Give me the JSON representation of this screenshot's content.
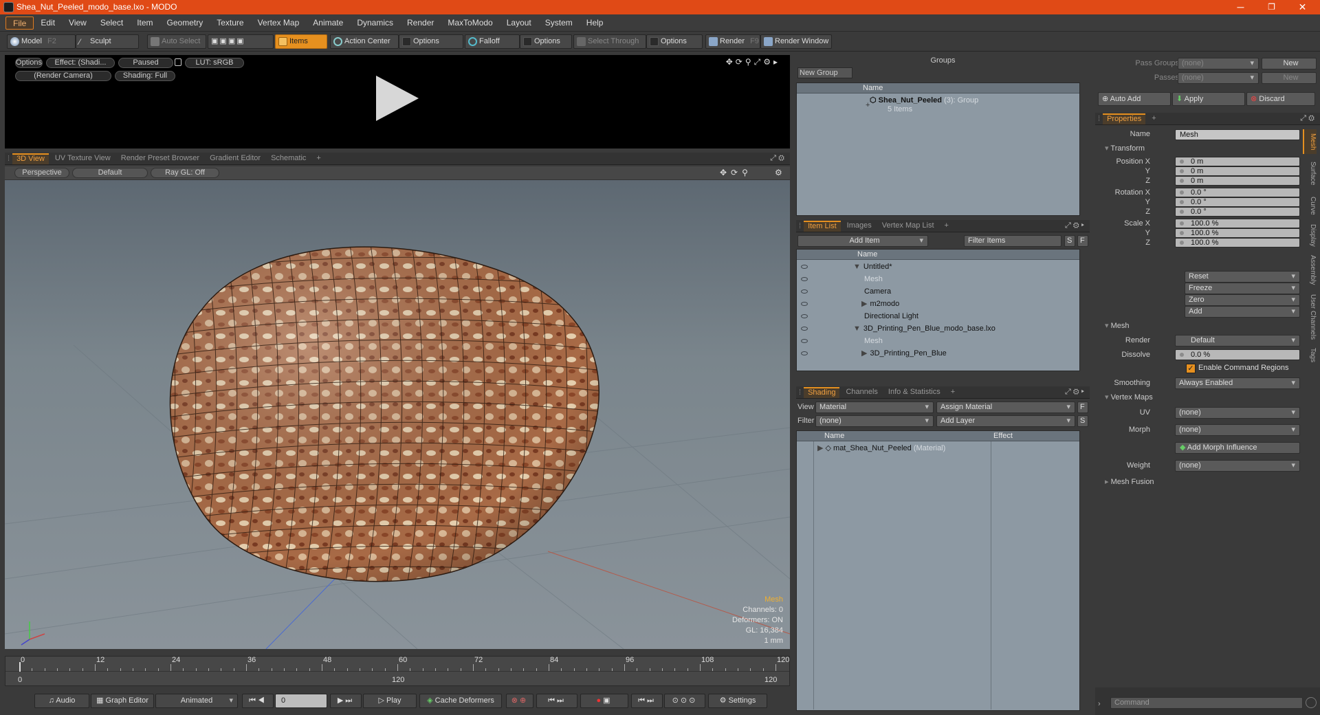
{
  "window": {
    "title": "Shea_Nut_Peeled_modo_base.lxo - MODO",
    "minimize": "─",
    "restore": "❐",
    "close": "✕"
  },
  "menu": [
    "File",
    "Edit",
    "View",
    "Select",
    "Item",
    "Geometry",
    "Texture",
    "Vertex Map",
    "Animate",
    "Dynamics",
    "Render",
    "MaxToModo",
    "Layout",
    "System",
    "Help"
  ],
  "toolbar": {
    "model": "Model",
    "model_key": "F2",
    "sculpt": "Sculpt",
    "auto_select": "Auto Select",
    "items": "Items",
    "action_center": "Action Center",
    "options1": "Options",
    "falloff": "Falloff",
    "options2": "Options",
    "select_through": "Select Through",
    "options3": "Options",
    "render": "Render",
    "render_key": "F9",
    "render_window": "Render Window"
  },
  "preview": {
    "options": "Options",
    "effect": "Effect: (Shadi...",
    "paused": "Paused",
    "lut": "LUT: sRGB",
    "camera": "(Render Camera)",
    "shading": "Shading: Full"
  },
  "view_tabs": [
    "3D View",
    "UV Texture View",
    "Render Preset Browser",
    "Gradient Editor",
    "Schematic",
    "+"
  ],
  "viewport": {
    "projection": "Perspective",
    "style": "Default",
    "raygl": "Ray GL: Off",
    "info": {
      "selection": "Mesh",
      "channels": "Channels: 0",
      "deformers": "Deformers: ON",
      "gl": "GL: 16,384",
      "unit": "1 mm"
    }
  },
  "timeline": {
    "ticks": [
      "0",
      "12",
      "24",
      "36",
      "48",
      "60",
      "72",
      "84",
      "96",
      "108",
      "120"
    ],
    "start": "0",
    "mid": "120",
    "end": "120"
  },
  "bottom": {
    "audio": "Audio",
    "graph_editor": "Graph Editor",
    "animated": "Animated",
    "frame": "0",
    "play": "Play",
    "cache": "Cache Deformers",
    "settings": "Settings"
  },
  "groups": {
    "title": "Groups",
    "new_group": "New Group",
    "col_name": "Name",
    "group_name": "Shea_Nut_Peeled",
    "group_count": "(3)",
    "group_type": ": Group",
    "group_items": "5 Items"
  },
  "itemlist": {
    "tabs": [
      "Item List",
      "Images",
      "Vertex Map List",
      "+"
    ],
    "add_item": "Add Item",
    "filter": "Filter Items",
    "S": "S",
    "F": "F",
    "col_name": "Name",
    "items": [
      {
        "name": "Untitled*",
        "depth": 0,
        "dim": false,
        "exp": "▼"
      },
      {
        "name": "Mesh",
        "depth": 1,
        "dim": true,
        "exp": ""
      },
      {
        "name": "Camera",
        "depth": 1,
        "dim": false,
        "exp": ""
      },
      {
        "name": "m2modo",
        "depth": 1,
        "dim": false,
        "exp": "▶"
      },
      {
        "name": "Directional Light",
        "depth": 1,
        "dim": false,
        "exp": ""
      },
      {
        "name": "3D_Printing_Pen_Blue_modo_base.lxo",
        "depth": 0,
        "dim": false,
        "exp": "▼"
      },
      {
        "name": "Mesh",
        "depth": 1,
        "dim": true,
        "exp": ""
      },
      {
        "name": "3D_Printing_Pen_Blue",
        "depth": 1,
        "dim": false,
        "exp": "▶"
      }
    ]
  },
  "shading": {
    "tabs": [
      "Shading",
      "Channels",
      "Info & Statistics",
      "+"
    ],
    "view_label": "View",
    "view_val": "Material",
    "assign": "Assign Material",
    "F": "F",
    "filter_label": "Filter",
    "filter_val": "(none)",
    "add_layer": "Add Layer",
    "S": "S",
    "col_name": "Name",
    "col_effect": "Effect",
    "mat": "mat_Shea_Nut_Peeled",
    "mat_type": "(Material)"
  },
  "props": {
    "pass_groups": "Pass Groups",
    "passes": "Passes",
    "none1": "(none)",
    "none2": "(none)",
    "new1": "New",
    "new2": "New",
    "auto_add": "Auto Add",
    "apply": "Apply",
    "discard": "Discard",
    "tab": "Properties",
    "plus": "+",
    "name_label": "Name",
    "name_val": "Mesh",
    "transform": "Transform",
    "pos_label": "Position X",
    "pos": [
      "0 m",
      "0 m",
      "0 m"
    ],
    "rot_label": "Rotation X",
    "rot": [
      "0.0 °",
      "0.0 °",
      "0.0 °"
    ],
    "scale_label": "Scale X",
    "scale": [
      "100.0 %",
      "100.0 %",
      "100.0 %"
    ],
    "Y": "Y",
    "Z": "Z",
    "reset": "Reset",
    "freeze": "Freeze",
    "zero": "Zero",
    "add": "Add",
    "mesh": "Mesh",
    "render_label": "Render",
    "render_val": "Default",
    "dissolve_label": "Dissolve",
    "dissolve_val": "0.0 %",
    "ecr": "Enable Command Regions",
    "smoothing_label": "Smoothing",
    "smoothing_val": "Always Enabled",
    "vertex_maps": "Vertex Maps",
    "uv_label": "UV",
    "uv_val": "(none)",
    "morph_label": "Morph",
    "morph_val": "(none)",
    "add_morph": "Add Morph Influence",
    "weight_label": "Weight",
    "weight_val": "(none)",
    "mesh_fusion": "Mesh Fusion",
    "vtabs": [
      "Mesh",
      "Surface",
      "Curve",
      "Display",
      "Assembly",
      "User Channels",
      "Tags"
    ],
    "command": "Command"
  }
}
